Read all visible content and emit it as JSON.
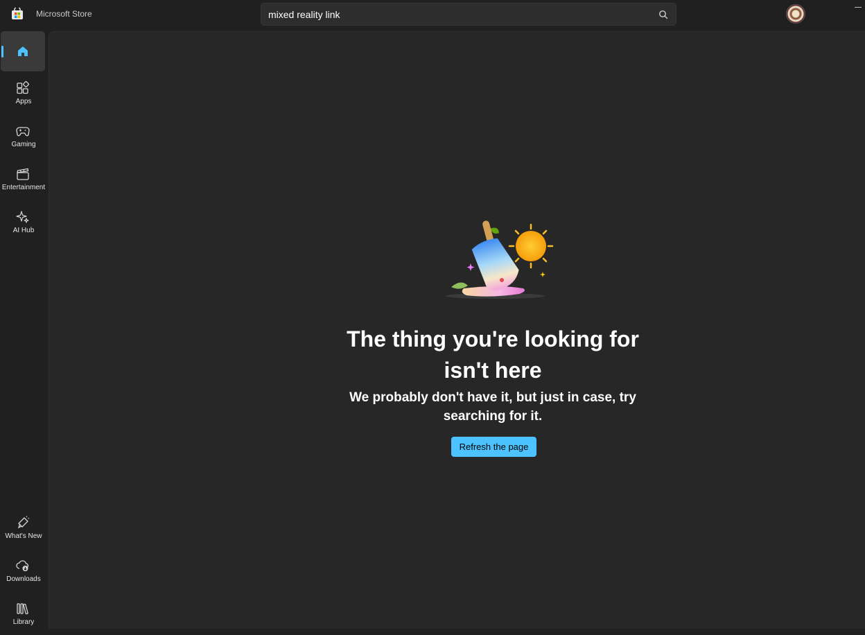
{
  "titlebar": {
    "app_title": "Microsoft Store",
    "search_value": "mixed reality link"
  },
  "sidebar": {
    "items": [
      {
        "label": "",
        "icon": "home-icon",
        "active": true
      },
      {
        "label": "Apps",
        "icon": "apps-icon"
      },
      {
        "label": "Gaming",
        "icon": "gamepad-icon"
      },
      {
        "label": "Entertainment",
        "icon": "clapperboard-icon"
      },
      {
        "label": "AI Hub",
        "icon": "sparkle-icon"
      }
    ],
    "bottom_items": [
      {
        "label": "What's New",
        "icon": "megaphone-icon"
      },
      {
        "label": "Downloads",
        "icon": "cloud-download-icon"
      },
      {
        "label": "Library",
        "icon": "library-icon"
      }
    ]
  },
  "main": {
    "heading": "The thing you're looking for isn't here",
    "subheading": "We probably don't have it, but just in case, try searching for it.",
    "refresh_label": "Refresh the page"
  },
  "colors": {
    "accent": "#4cc2ff",
    "background": "#202020",
    "content_background": "#272727"
  }
}
